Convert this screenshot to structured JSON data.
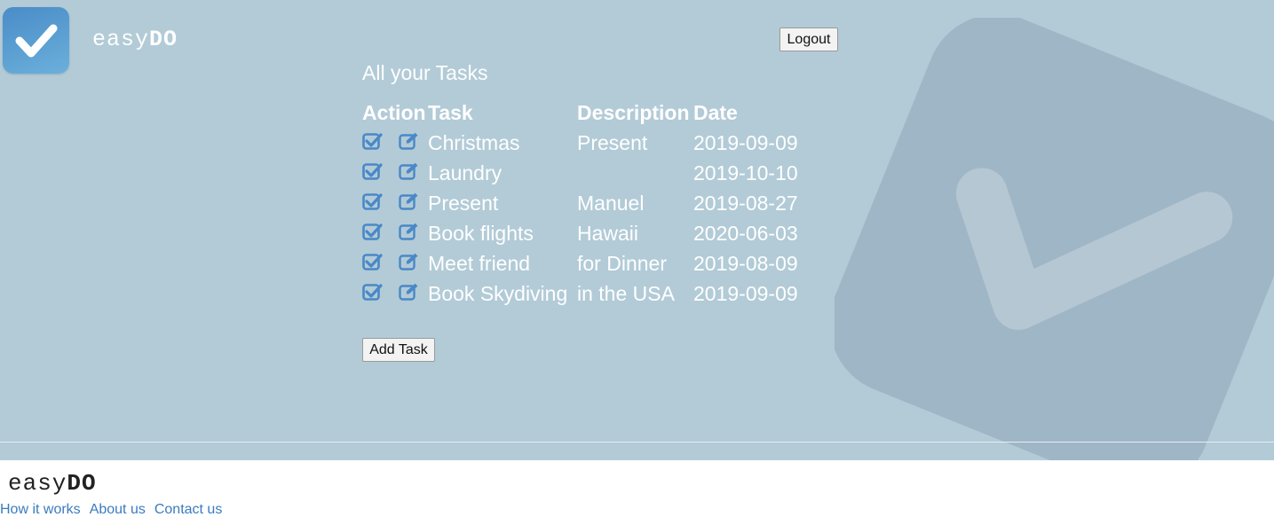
{
  "brand": {
    "name_light": "easy",
    "name_bold": "DO"
  },
  "header": {
    "logout_label": "Logout"
  },
  "main": {
    "heading": "All your Tasks",
    "columns": [
      "Action",
      "Task",
      "Description",
      "Date"
    ],
    "tasks": [
      {
        "task": "Christmas",
        "description": "Present",
        "date": "2019-09-09"
      },
      {
        "task": "Laundry",
        "description": "",
        "date": "2019-10-10"
      },
      {
        "task": "Present",
        "description": "Manuel",
        "date": "2019-08-27"
      },
      {
        "task": "Book flights",
        "description": "Hawaii",
        "date": "2020-06-03"
      },
      {
        "task": "Meet friend",
        "description": "for Dinner",
        "date": "2019-08-09"
      },
      {
        "task": "Book Skydiving",
        "description": "in the USA",
        "date": "2019-09-09"
      }
    ],
    "add_task_label": "Add Task",
    "row_icons": [
      "check-square-icon",
      "edit-icon"
    ]
  },
  "footer": {
    "name_light": "easy",
    "name_bold": "DO",
    "links": [
      "How it works",
      "About us",
      "Contact us"
    ]
  },
  "colors": {
    "hero_bg": "#b2cbd7",
    "accent_blue": "#4a88c7",
    "link_blue": "#3b7bbf",
    "text_on_hero": "#ffffff"
  }
}
